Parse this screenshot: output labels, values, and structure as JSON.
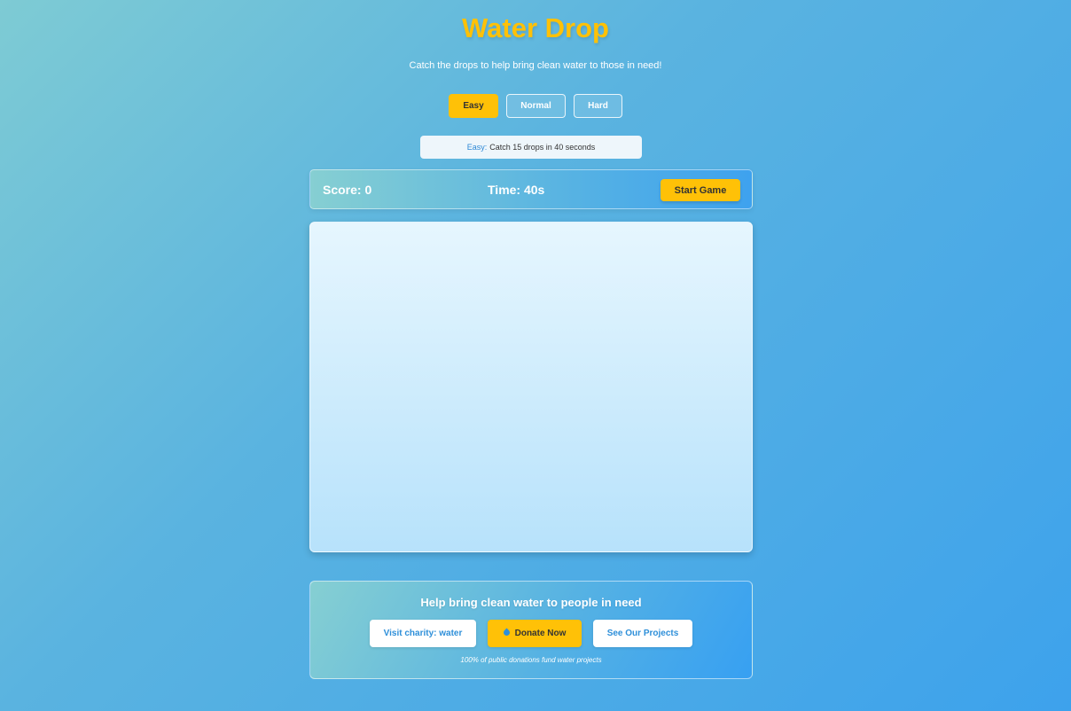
{
  "app": {
    "title": "Water Drop",
    "subtitle": "Catch the drops to help bring clean water to those in need!"
  },
  "difficulty": {
    "options": [
      "Easy",
      "Normal",
      "Hard"
    ],
    "selected": "Easy"
  },
  "info": {
    "level": "Easy:",
    "text": "Catch 15 drops in 40 seconds"
  },
  "scorebar": {
    "score_label": "Score: 0",
    "time_label": "Time: 40s",
    "start_label": "Start Game"
  },
  "charity": {
    "title": "Help bring clean water to people in need",
    "visit_label": "Visit charity: water",
    "donate_label": "Donate Now",
    "donate_icon": "water-drop-icon",
    "projects_label": "See Our Projects",
    "note": "100% of public donations fund water projects"
  },
  "colors": {
    "accent": "#ffc107",
    "link_blue": "#2e8fd9"
  }
}
